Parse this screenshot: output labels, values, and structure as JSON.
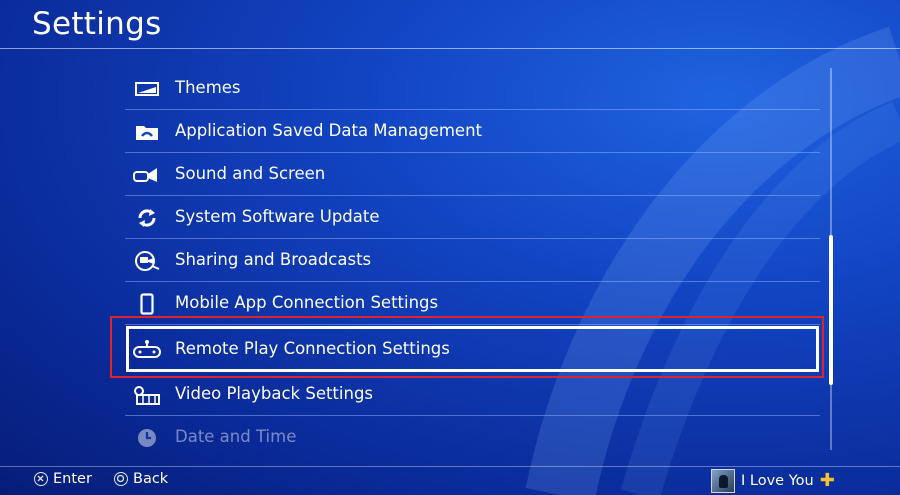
{
  "header": {
    "title": "Settings"
  },
  "menu": {
    "items": [
      {
        "label": "Themes",
        "icon": "themes-icon"
      },
      {
        "label": "Application Saved Data Management",
        "icon": "saved-data-icon"
      },
      {
        "label": "Sound and Screen",
        "icon": "sound-screen-icon"
      },
      {
        "label": "System Software Update",
        "icon": "update-icon"
      },
      {
        "label": "Sharing and Broadcasts",
        "icon": "sharing-icon"
      },
      {
        "label": "Mobile App Connection Settings",
        "icon": "mobile-icon"
      },
      {
        "label": "Remote Play Connection Settings",
        "icon": "remote-play-icon",
        "selected": true
      },
      {
        "label": "Video Playback Settings",
        "icon": "video-playback-icon"
      },
      {
        "label": "Date and Time",
        "icon": "clock-icon"
      }
    ]
  },
  "footer": {
    "enter_label": "Enter",
    "back_label": "Back",
    "username": "I Love You"
  },
  "colors": {
    "background": "#1244c2",
    "highlight_border": "#e0222f",
    "plus_icon": "#f1c232"
  }
}
